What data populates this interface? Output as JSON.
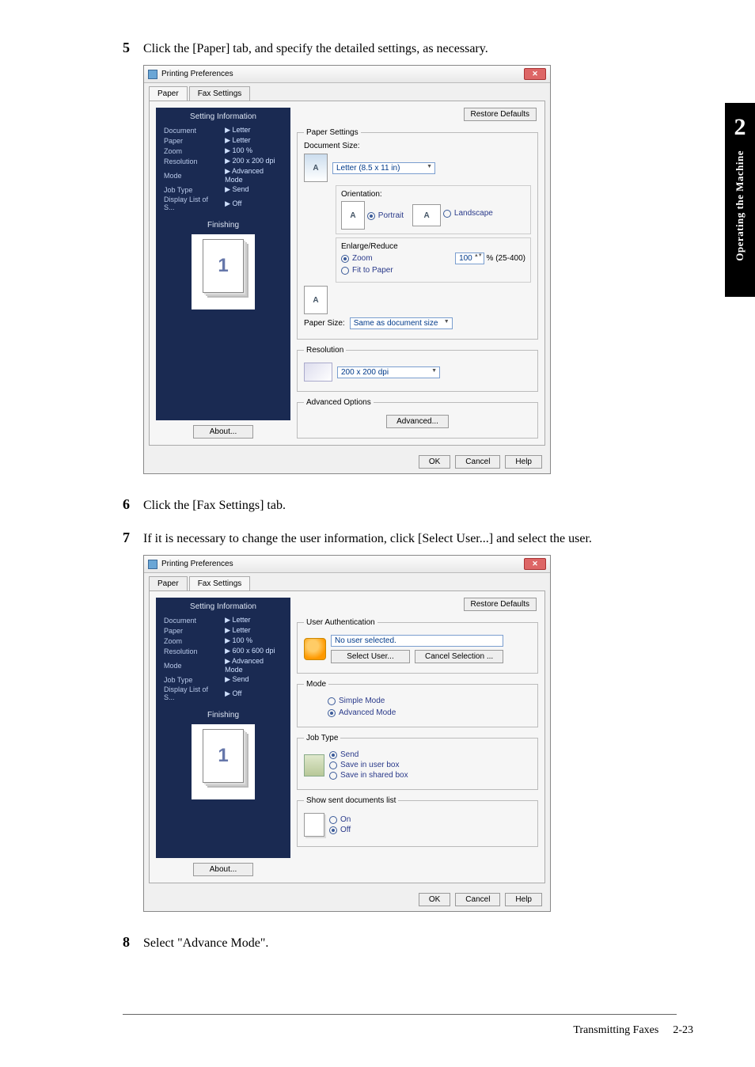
{
  "sideTab": {
    "chapter": "2",
    "label": "Operating the Machine"
  },
  "footer": {
    "title": "Transmitting Faxes",
    "page": "2-23"
  },
  "step5": {
    "num": "5",
    "text": "Click the [Paper] tab, and specify the detailed settings, as necessary."
  },
  "step6": {
    "num": "6",
    "text": "Click the [Fax Settings] tab."
  },
  "step7": {
    "num": "7",
    "text": "If it is necessary to change the user information, click [Select User...] and select the user."
  },
  "step8": {
    "num": "8",
    "text": "Select \"Advance Mode\"."
  },
  "dlg1": {
    "title": "Printing Preferences",
    "tabs": {
      "paper": "Paper",
      "fax": "Fax Settings"
    },
    "restore": "Restore Defaults",
    "about": "About...",
    "info_header": "Setting Information",
    "info": {
      "Document": "Letter",
      "Paper": "Letter",
      "Zoom": "100 %",
      "Resolution": "200 x 200 dpi",
      "Mode": "Advanced Mode",
      "Job Type": "Send",
      "Display List of S...": "Off"
    },
    "finishing": "Finishing",
    "finishing_num": "1",
    "paperSettings": {
      "legend": "Paper Settings",
      "docsize_lbl": "Document Size:",
      "docsize_val": "Letter (8.5 x 11 in)",
      "orient_lbl": "Orientation:",
      "orient_portrait": "Portrait",
      "orient_landscape": "Landscape",
      "enlarge_lbl": "Enlarge/Reduce",
      "zoom": "Zoom",
      "zoom_val": "100",
      "zoom_range": "% (25-400)",
      "fit": "Fit to Paper",
      "papersize_lbl": "Paper Size:",
      "papersize_val": "Same as document size"
    },
    "resolution": {
      "legend": "Resolution",
      "val": "200 x 200 dpi"
    },
    "advanced": {
      "legend": "Advanced Options",
      "btn": "Advanced..."
    },
    "footer": {
      "ok": "OK",
      "cancel": "Cancel",
      "help": "Help"
    }
  },
  "dlg2": {
    "title": "Printing Preferences",
    "tabs": {
      "paper": "Paper",
      "fax": "Fax Settings"
    },
    "restore": "Restore Defaults",
    "about": "About...",
    "info_header": "Setting Information",
    "info": {
      "Document": "Letter",
      "Paper": "Letter",
      "Zoom": "100 %",
      "Resolution": "600 x 600 dpi",
      "Mode": "Advanced Mode",
      "Job Type": "Send",
      "Display List of S...": "Off"
    },
    "finishing": "Finishing",
    "finishing_num": "1",
    "auth": {
      "legend": "User Authentication",
      "status": "No user selected.",
      "select": "Select User...",
      "cancel": "Cancel Selection ..."
    },
    "mode": {
      "legend": "Mode",
      "simple": "Simple Mode",
      "adv": "Advanced Mode"
    },
    "job": {
      "legend": "Job Type",
      "send": "Send",
      "user": "Save in user box",
      "shared": "Save in shared box"
    },
    "showlist": {
      "legend": "Show sent documents list",
      "on": "On",
      "off": "Off"
    },
    "footer": {
      "ok": "OK",
      "cancel": "Cancel",
      "help": "Help"
    }
  }
}
